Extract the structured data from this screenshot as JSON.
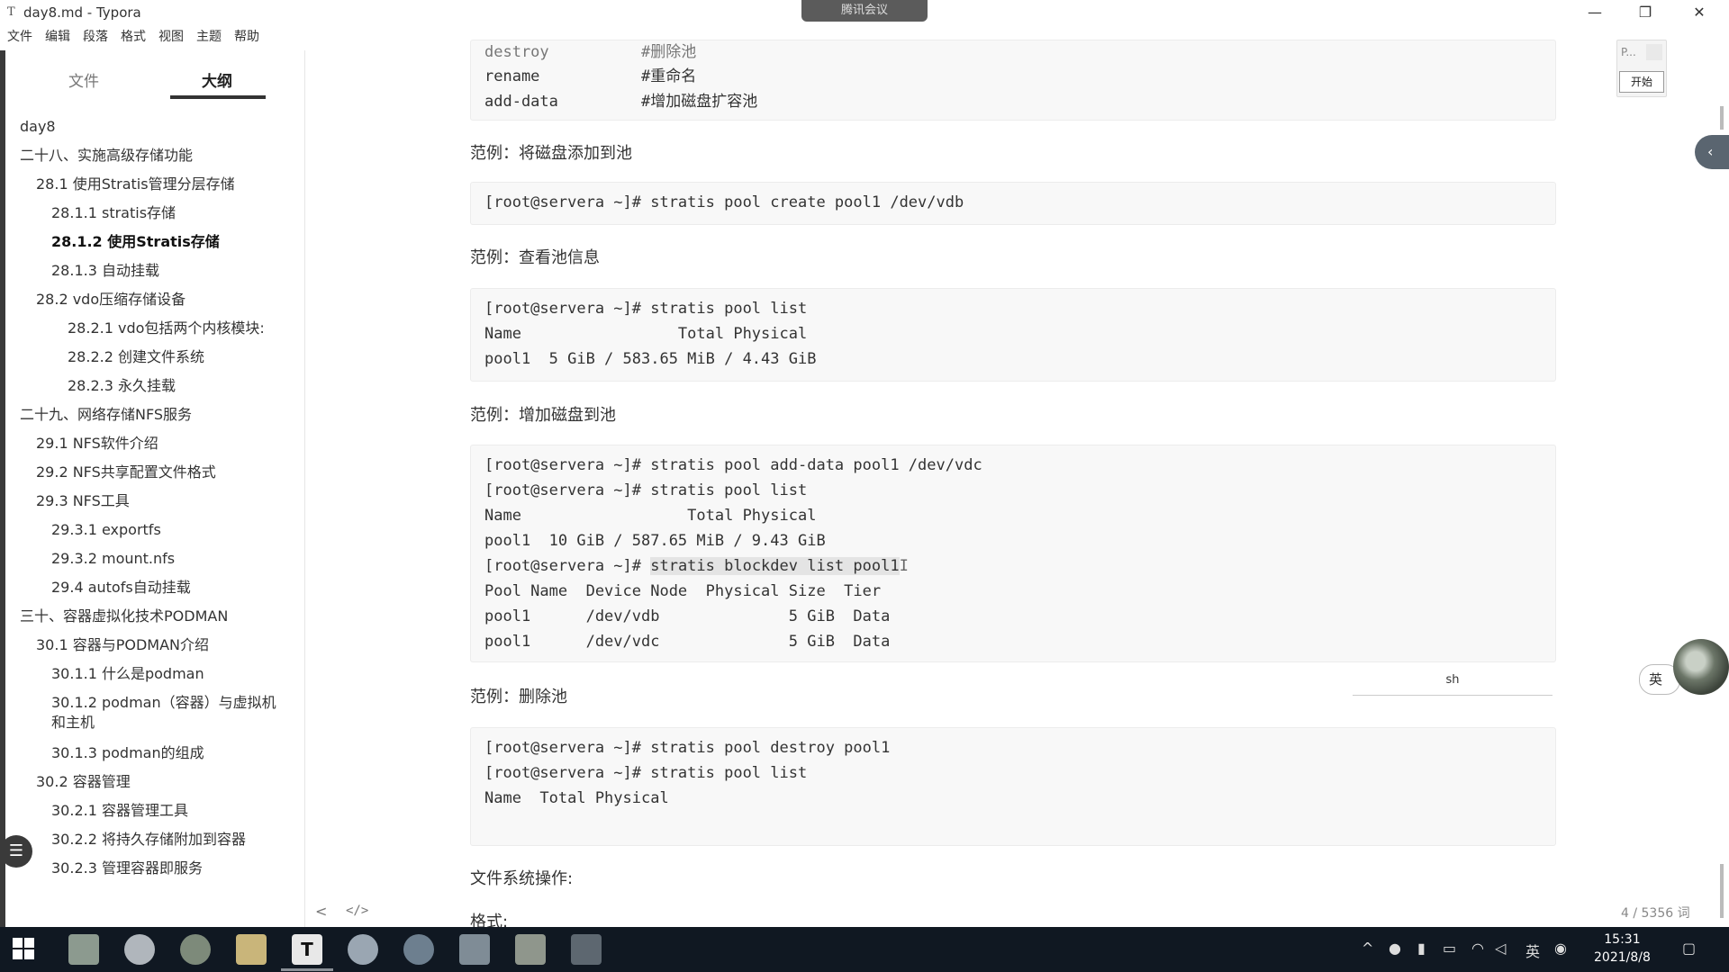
{
  "window": {
    "title": "day8.md - Typora",
    "app_icon": "T",
    "meeting_pill": "腾讯会议",
    "controls": {
      "minimize": "—",
      "restore": "❐",
      "close": "✕"
    }
  },
  "menu": [
    "文件",
    "编辑",
    "段落",
    "格式",
    "视图",
    "主题",
    "帮助"
  ],
  "sidebar": {
    "tabs": {
      "files": "文件",
      "outline": "大纲"
    },
    "outline": [
      "day8",
      "二十八、实施高级存储功能",
      "28.1 使用Stratis管理分层存储",
      "28.1.1 stratis存储",
      "28.1.2 使用Stratis存储",
      "28.1.3 自动挂载",
      "28.2 vdo压缩存储设备",
      "28.2.1 vdo包括两个内核模块:",
      "28.2.2 创建文件系统",
      "28.2.3 永久挂载",
      "二十九、网络存储NFS服务",
      "29.1 NFS软件介绍",
      "29.2 NFS共享配置文件格式",
      "29.3 NFS工具",
      "29.3.1 exportfs",
      "29.3.2 mount.nfs",
      "29.4 autofs自动挂载",
      "三十、容器虚拟化技术PODMAN",
      "30.1 容器与PODMAN介绍",
      "30.1.1 什么是podman",
      "30.1.2 podman（容器）与虚拟机",
      "和主机",
      "30.1.3 podman的组成",
      "30.2 容器管理",
      "30.2.1 容器管理工具",
      "30.2.2 将持久存储附加到容器",
      "30.2.3 管理容器即服务"
    ]
  },
  "doc": {
    "block0": [
      "destroy          #删除池",
      "rename           #重命名",
      "add-data         #增加磁盘扩容池"
    ],
    "h1": "范例：将磁盘添加到池",
    "block1": [
      "[root@servera ~]# stratis pool create pool1 /dev/vdb"
    ],
    "h2": "范例：查看池信息",
    "block2": [
      "[root@servera ~]# stratis pool list",
      "Name                 Total Physical",
      "pool1  5 GiB / 583.65 MiB / 4.43 GiB"
    ],
    "h3": "范例：增加磁盘到池",
    "block3": [
      "[root@servera ~]# stratis pool add-data pool1 /dev/vdc",
      "[root@servera ~]# stratis pool list",
      "Name                  Total Physical",
      "pool1  10 GiB / 587.65 MiB / 9.43 GiB",
      "[root@servera ~]# ",
      "Pool Name  Device Node  Physical Size  Tier",
      "pool1      /dev/vdb              5 GiB  Data",
      "pool1      /dev/vdc              5 GiB  Data"
    ],
    "block3_selected": "stratis blockdev list pool1",
    "h4": "范例：删除池",
    "block4": [
      "[root@servera ~]# stratis pool destroy pool1",
      "[root@servera ~]# stratis pool list",
      "Name  Total Physical"
    ],
    "h5": "文件系统操作:",
    "h6": "格式:",
    "code_lang": "sh"
  },
  "floating": {
    "mini_p": "P...",
    "start_button": "开始",
    "ime": "英",
    "collapse": "‹",
    "fab": "☰"
  },
  "status": {
    "back": "<",
    "source": "</>",
    "wordcount": "4 / 5356 词"
  },
  "taskbar": {
    "time": "15:31",
    "date": "2021/8/8",
    "ime": "英",
    "tray_up": "^"
  }
}
